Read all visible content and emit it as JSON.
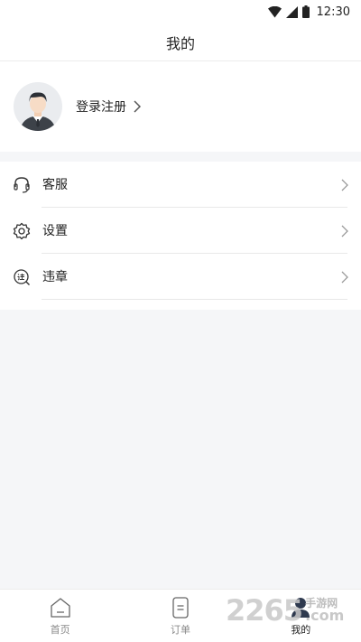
{
  "status_bar": {
    "time": "12:30",
    "icons": [
      "wifi-icon",
      "signal-icon",
      "battery-icon"
    ]
  },
  "header": {
    "title": "我的"
  },
  "profile": {
    "login_label": "登录注册",
    "avatar_icon": "avatar-icon"
  },
  "menu": {
    "items": [
      {
        "label": "客服",
        "icon": "headset-icon"
      },
      {
        "label": "设置",
        "icon": "gear-icon"
      },
      {
        "label": "违章",
        "icon": "violation-icon"
      }
    ]
  },
  "tabbar": {
    "tabs": [
      {
        "label": "首页",
        "icon": "home-icon",
        "active": false
      },
      {
        "label": "订单",
        "icon": "order-icon",
        "active": false
      },
      {
        "label": "我的",
        "icon": "profile-icon",
        "active": true
      }
    ]
  },
  "watermark": {
    "number": "2265",
    "text": "手游网",
    "domain": ".com"
  },
  "colors": {
    "background": "#f5f6f8",
    "card": "#ffffff",
    "divider": "#e8e8e8",
    "text": "#222222",
    "muted": "#888888"
  }
}
